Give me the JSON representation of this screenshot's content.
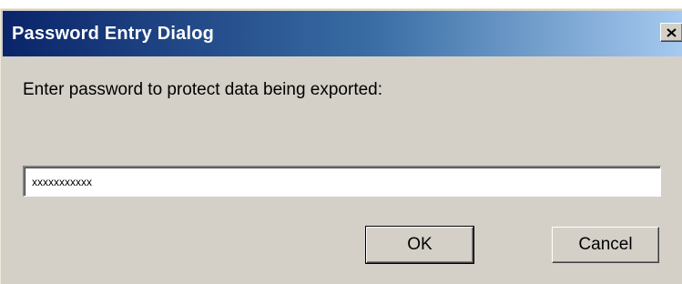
{
  "dialog": {
    "title": "Password Entry Dialog",
    "close_icon": "close-x-icon",
    "prompt": "Enter password to protect data being exported:",
    "password_value": "xxxxxxxxxxx",
    "ok_label": "OK",
    "cancel_label": "Cancel"
  },
  "colors": {
    "titlebar_start": "#0a246a",
    "titlebar_end": "#a6caf0",
    "dialog_bg": "#d4d0c8"
  }
}
